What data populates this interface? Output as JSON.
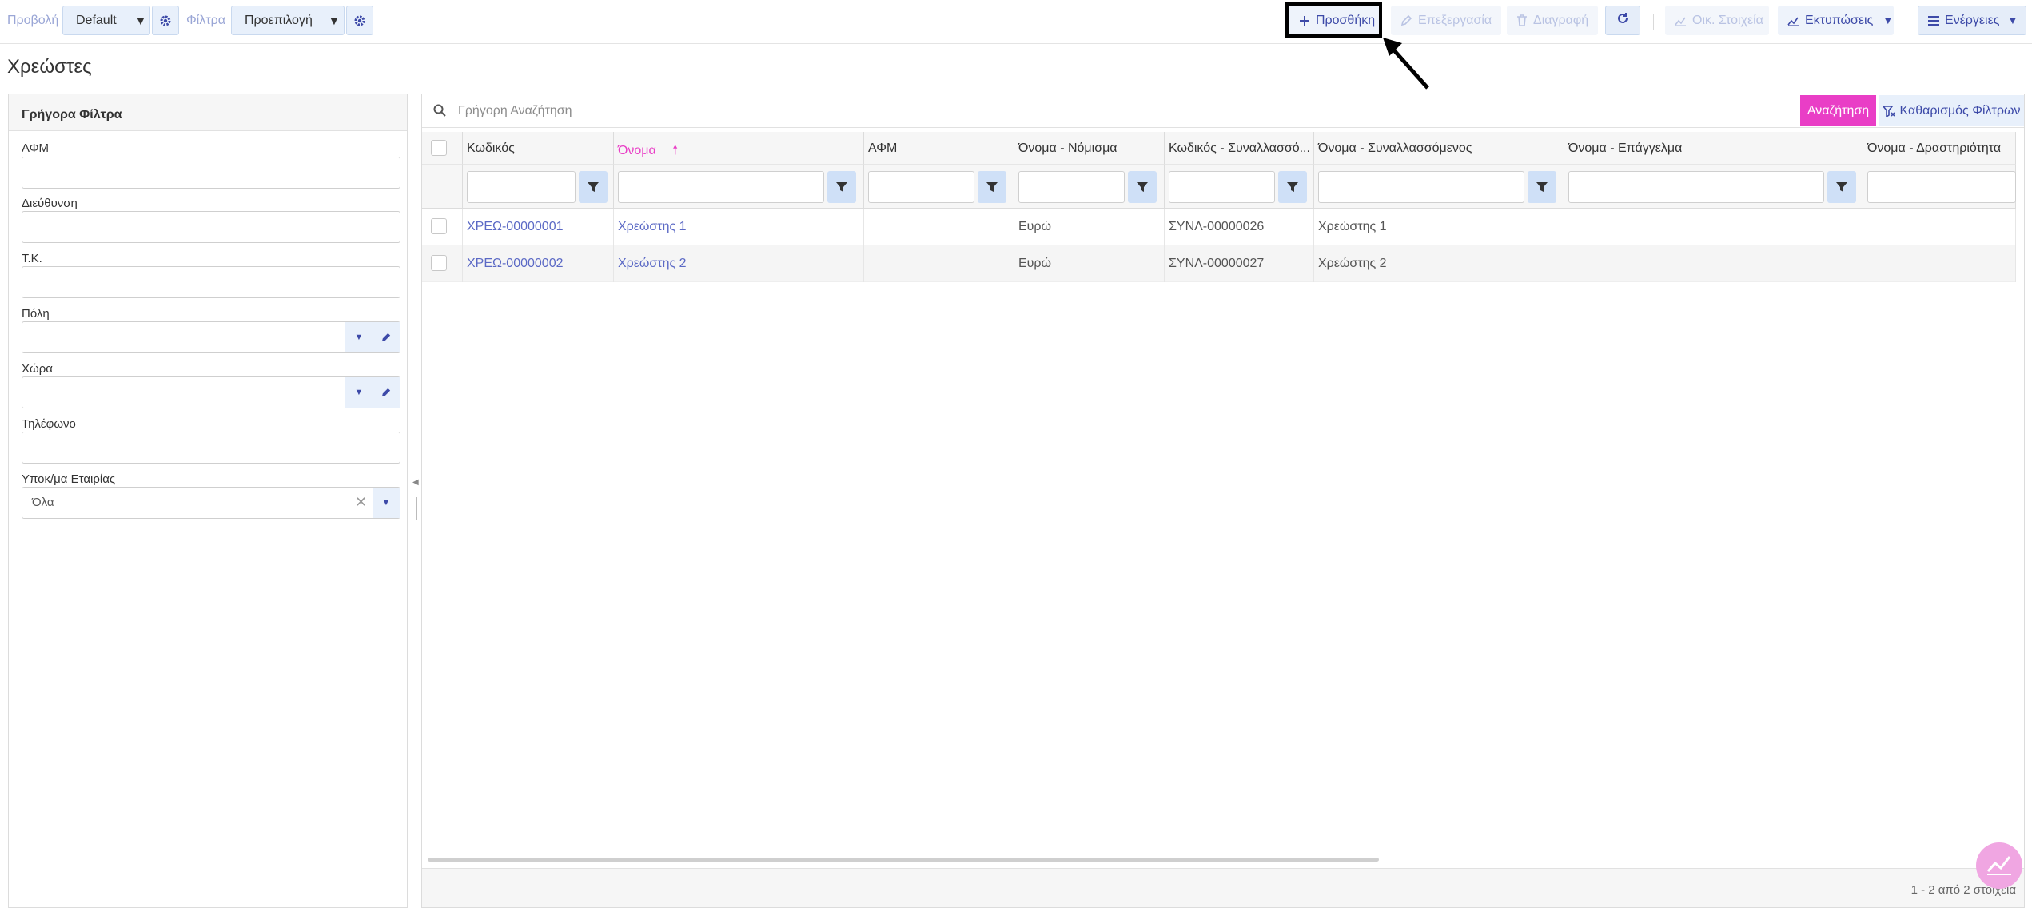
{
  "toolbar": {
    "view_label": "Προβολή",
    "view_value": "Default",
    "filter_label": "Φίλτρα",
    "filter_value": "Προεπιλογή",
    "add": "Προσθήκη",
    "edit": "Επεξεργασία",
    "delete": "Διαγραφή",
    "financial": "Οικ. Στοιχεία",
    "prints": "Εκτυπώσεις",
    "actions": "Ενέργειες"
  },
  "page": {
    "title": "Χρεώστες"
  },
  "quick_filters": {
    "title": "Γρήγορα Φίλτρα",
    "afm": "ΑΦΜ",
    "address": "Διεύθυνση",
    "zip": "Τ.Κ.",
    "city": "Πόλη",
    "country": "Χώρα",
    "phone": "Τηλέφωνο",
    "branch": "Υποκ/μα Εταιρίας",
    "branch_value": "Όλα"
  },
  "grid": {
    "search_placeholder": "Γρήγορη Αναζήτηση",
    "search_button": "Αναζήτηση",
    "clear_filters": "Καθαρισμός Φίλτρων",
    "columns": [
      "Κωδικός",
      "Όνομα",
      "ΑΦΜ",
      "Όνομα - Νόμισμα",
      "Κωδικός - Συναλλασσό...",
      "Όνομα - Συναλλασσόμενος",
      "Όνομα - Επάγγελμα",
      "Όνομα - Δραστηριότητα"
    ],
    "rows": [
      [
        "ΧΡΕΩ-00000001",
        "Χρεώστης 1",
        "",
        "Ευρώ",
        "ΣΥΝΛ-00000026",
        "Χρεώστης 1",
        "",
        ""
      ],
      [
        "ΧΡΕΩ-00000002",
        "Χρεώστης 2",
        "",
        "Ευρώ",
        "ΣΥΝΛ-00000027",
        "Χρεώστης 2",
        "",
        ""
      ]
    ],
    "footer": "1 - 2 από 2 στοιχεία"
  },
  "colors": {
    "accent": "#e93ec6",
    "link": "#5b69c5",
    "primary": "#3d4aa8"
  }
}
